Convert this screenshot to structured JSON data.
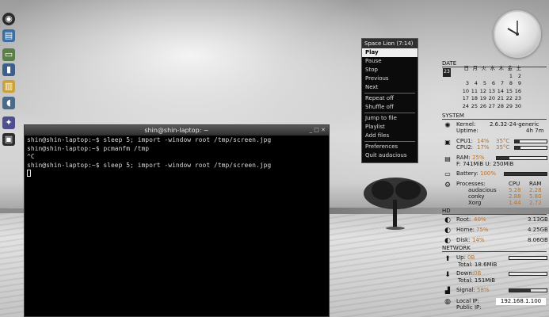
{
  "terminal": {
    "title": "shin@shin-laptop: ~",
    "lines": [
      "shin@shin-laptop:~$ sleep 5; import -window root /tmp/screen.jpg",
      "shin@shin-laptop:~$ pcmanfm /tmp",
      "^C",
      "shin@shin-laptop:~$ sleep 5; import -window root /tmp/screen.jpg"
    ]
  },
  "menu": {
    "title": "Space Lion (7:14)",
    "items": [
      "Play",
      "Stop",
      "Previous",
      "Next",
      "Repeat off",
      "Shuffle off",
      "Jump to file",
      "Playlist",
      "Add files",
      "Preferences",
      "Quit audacious"
    ],
    "pause_label": "Pause"
  },
  "conky": {
    "date_header": "DATE",
    "calendar_icon_day": "23",
    "calendar_weekdays": [
      "日",
      "月",
      "火",
      "水",
      "木",
      "金",
      "土"
    ],
    "calendar_rows": [
      [
        "",
        "",
        "",
        "",
        "",
        "1",
        "2"
      ],
      [
        "3",
        "4",
        "5",
        "6",
        "7",
        "8",
        "9"
      ],
      [
        "10",
        "11",
        "12",
        "13",
        "14",
        "15",
        "16"
      ],
      [
        "17",
        "18",
        "19",
        "20",
        "21",
        "22",
        "23"
      ],
      [
        "24",
        "25",
        "26",
        "27",
        "28",
        "29",
        "30"
      ]
    ],
    "system_header": "SYSTEM",
    "kernel_label": "Kernel:",
    "kernel_value": "2.6.32-24-generic",
    "uptime_label": "Uptime:",
    "uptime_value": "4h 7m",
    "cpu1_label": "CPU1:",
    "cpu1_value": "14%",
    "cpu1_temp": "35°C",
    "cpu1_fraction": 0.14,
    "cpu2_label": "CPU2:",
    "cpu2_value": "17%",
    "cpu2_temp": "35°C",
    "cpu2_fraction": 0.17,
    "ram_label": "RAM:",
    "ram_value": "25%",
    "ram_detail": "F: 741MiB U: 250MiB",
    "ram_fraction": 0.25,
    "battery_label": "Battery:",
    "battery_value": "100%",
    "battery_fraction": 1.0,
    "processes_label": "Processes:",
    "proc_cpu_header": "CPU",
    "proc_ram_header": "RAM",
    "processes": [
      {
        "name": "audacious",
        "cpu": "5.28",
        "ram": "2.28"
      },
      {
        "name": "conky",
        "cpu": "2.88",
        "ram": "5.80"
      },
      {
        "name": "Xorg",
        "cpu": "1.44",
        "ram": "2.72"
      }
    ],
    "hd_header": "HD",
    "root_label": "Root:",
    "root_value": "40%",
    "root_size": "3.13GB",
    "home_label": "Home:",
    "home_value": "75%",
    "home_size": "4.25GB",
    "disk_label": "Disk:",
    "disk_value": "14%",
    "disk_size": "8.06GB",
    "network_header": "NETWORK",
    "up_label": "Up:",
    "up_value": "0B",
    "up_total": "Total: 18.6MiB",
    "down_label": "Down:",
    "down_value": "0B",
    "down_total": "Total: 151MiB",
    "signal_label": "Signal:",
    "signal_value": "58%",
    "signal_fraction": 0.58,
    "local_ip_label": "Local IP:",
    "local_ip_value": "192.168.1.100",
    "public_ip_label": "Public IP:"
  }
}
